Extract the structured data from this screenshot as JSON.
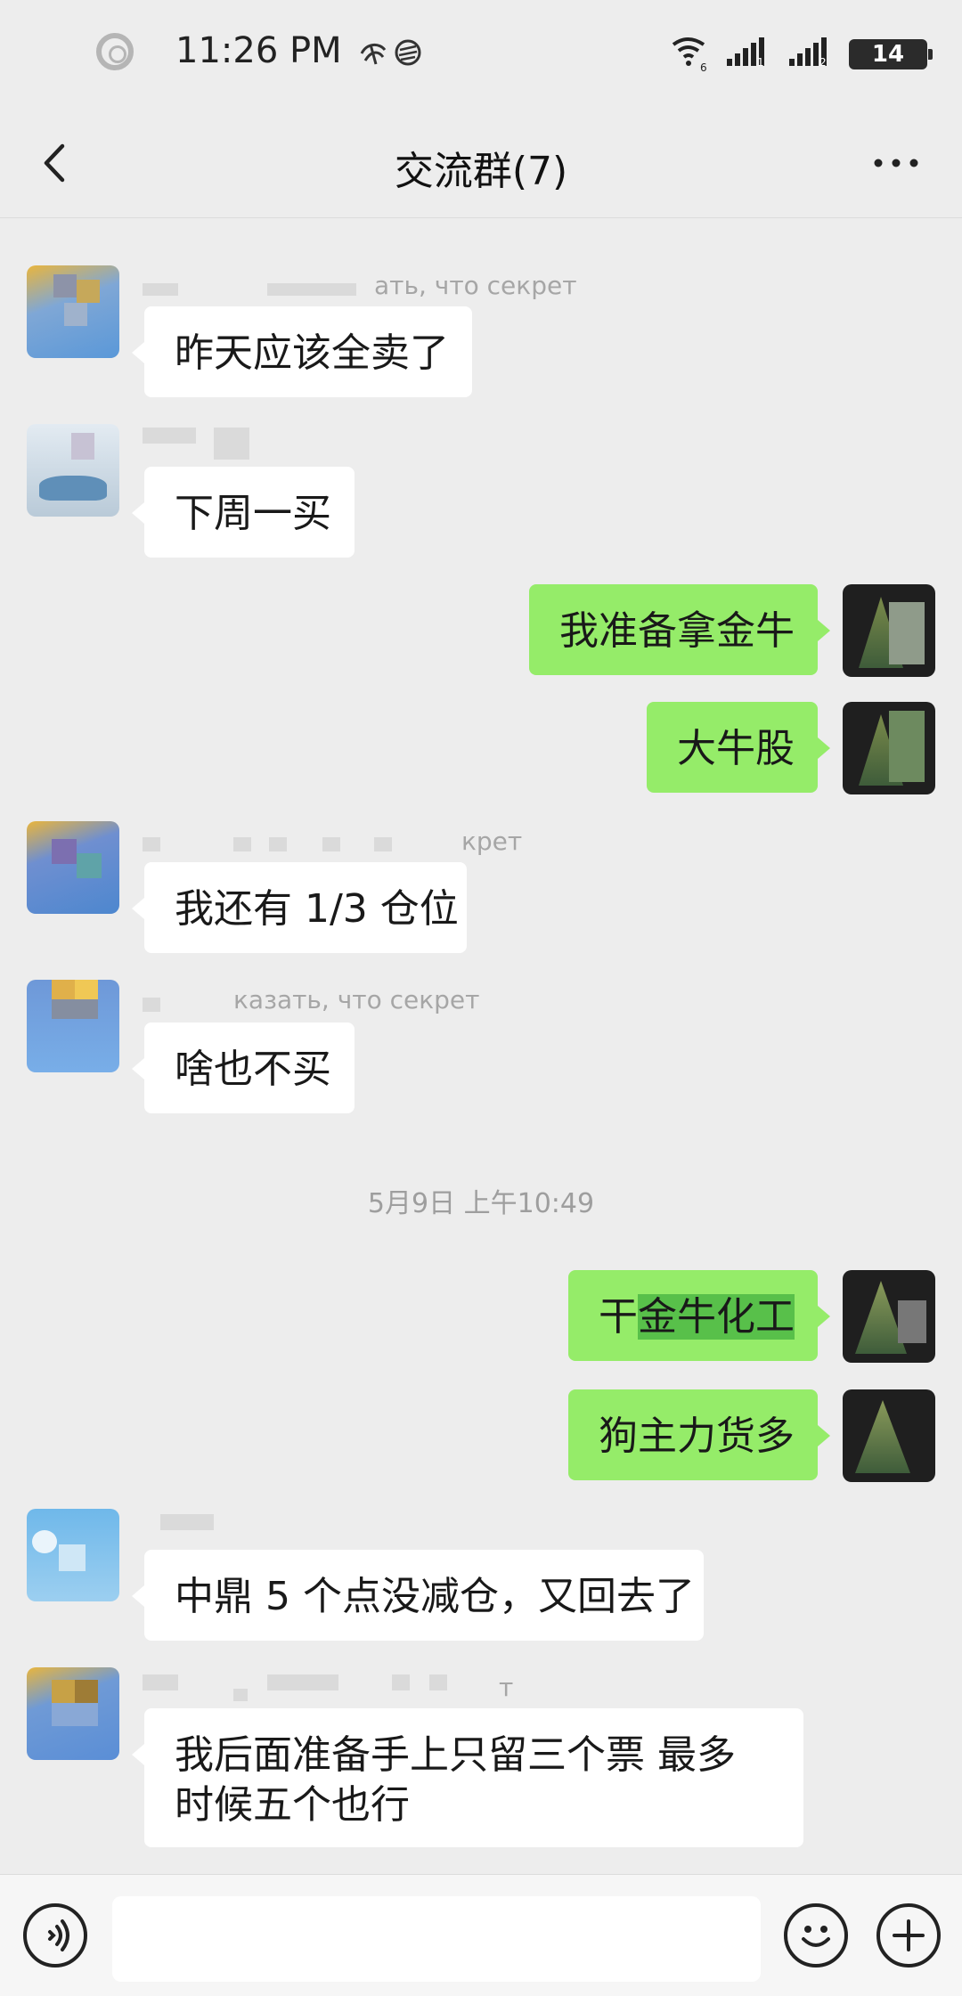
{
  "status_bar": {
    "time": "11:26 PM",
    "battery": "14",
    "wifi_sub": "6",
    "sim1": "1",
    "sim2": "2"
  },
  "header": {
    "title": "交流群(7)"
  },
  "messages": [
    {
      "name": "ать, что секрет",
      "text": "昨天应该全卖了"
    },
    {
      "name": "",
      "text": "下周一买"
    },
    {
      "text": "我准备拿金牛"
    },
    {
      "text": "大牛股"
    },
    {
      "name": "крет",
      "text": "我还有 1/3 仓位"
    },
    {
      "name": "казать, что секрет",
      "text": "啥也不买"
    },
    {
      "text_plain": "干",
      "text_highlight": "金牛化工"
    },
    {
      "text": "狗主力货多"
    },
    {
      "name": "",
      "text": "中鼎 5 个点没减仓，又回去了"
    },
    {
      "name": "т",
      "text": "我后面准备手上只留三个票 最多时候五个也行"
    }
  ],
  "timestamp": "5月9日 上午10:49",
  "colors": {
    "background": "#ededed",
    "self_bubble": "#95ec69",
    "other_bubble": "#ffffff"
  }
}
